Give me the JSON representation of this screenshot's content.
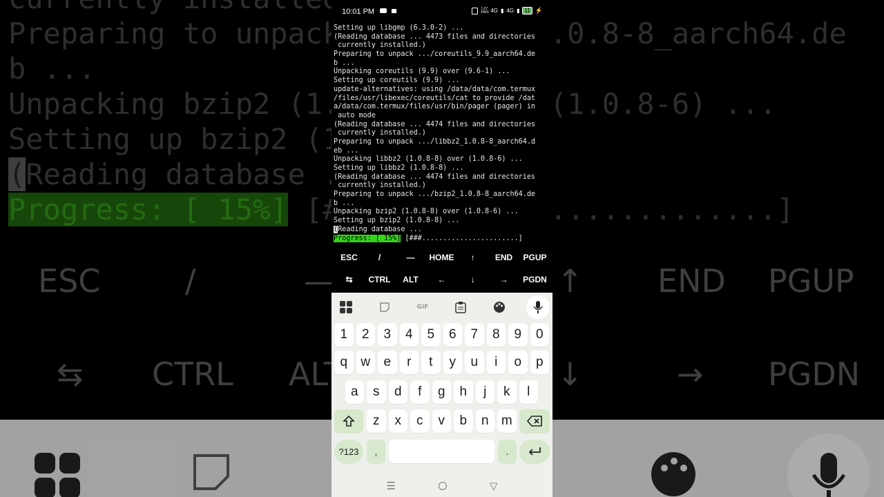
{
  "status": {
    "time": "10:01 PM",
    "signal_text": "1.07 KB/S",
    "network_4g": "4G",
    "network_4g2": "4G",
    "battery": "11"
  },
  "terminal": {
    "lines": [
      "Setting up libgmp (6.3.0-2) ...",
      "(Reading database ... 4473 files and directories",
      " currently installed.)",
      "Preparing to unpack .../coreutils_9.9_aarch64.de",
      "b ...",
      "Unpacking coreutils (9.9) over (9.6-1) ...",
      "Setting up coreutils (9.9) ...",
      "update-alternatives: using /data/data/com.termux",
      "/files/usr/libexec/coreutils/cat to provide /dat",
      "a/data/com.termux/files/usr/bin/pager (pager) in",
      " auto mode",
      "(Reading database ... 4474 files and directories",
      " currently installed.)",
      "Preparing to unpack .../libbz2_1.0.8-8_aarch64.d",
      "eb ...",
      "Unpacking libbz2 (1.0.8-8) over (1.0.8-6) ...",
      "Setting up libbz2 (1.0.8-8) ...",
      "(Reading database ... 4474 files and directories",
      " currently installed.)",
      "Preparing to unpack .../bzip2_1.0.8-8_aarch64.de",
      "b ...",
      "Unpacking bzip2 (1.0.8-8) over (1.0.8-6) ...",
      "Setting up bzip2 (1.0.8-8) ..."
    ],
    "cursor_char": "(",
    "current_line_rest": "Reading database ...",
    "progress_label": "Progress: [ 15%]",
    "progress_bar": " [###.......................]",
    "progress_percent": 15
  },
  "extra_keys": {
    "row1": [
      "ESC",
      "/",
      "—",
      "HOME",
      "↑",
      "END",
      "PGUP"
    ],
    "row2": [
      "⇆",
      "CTRL",
      "ALT",
      "←",
      "↓",
      "→",
      "PGDN"
    ]
  },
  "keyboard": {
    "toolbar_icons": [
      "apps-grid-icon",
      "sticker-icon",
      "gif-icon",
      "clipboard-icon",
      "palette-icon",
      "mic-icon"
    ],
    "gif_label": "GIF",
    "numbers": [
      "1",
      "2",
      "3",
      "4",
      "5",
      "6",
      "7",
      "8",
      "9",
      "0"
    ],
    "row_q": [
      "q",
      "w",
      "e",
      "r",
      "t",
      "y",
      "u",
      "i",
      "o",
      "p"
    ],
    "row_a": [
      "a",
      "s",
      "d",
      "f",
      "g",
      "h",
      "j",
      "k",
      "l"
    ],
    "row_z": [
      "z",
      "x",
      "c",
      "v",
      "b",
      "n",
      "m"
    ],
    "symbols_key": "?123",
    "comma": ",",
    "period": "."
  },
  "background": {
    "term_lines": [
      "currently installed.)",
      "Preparing to unpack .../bzip2_1.0.8-8_aarch64.de",
      "b ...",
      "Unpacking bzip2 (1.0.8-8) over (1.0.8-6) ...",
      "Setting up bzip2 (1.0.8-8) ..."
    ],
    "progress_label": "Progress: [ 15%]",
    "progress_bar": " [###.......................]",
    "cursor_char": "(",
    "current_line_rest": "Reading database ..."
  },
  "colors": {
    "progress_green": "#37d51a",
    "keyboard_bg": "#eef1eb",
    "special_key": "#d7e8cc"
  }
}
